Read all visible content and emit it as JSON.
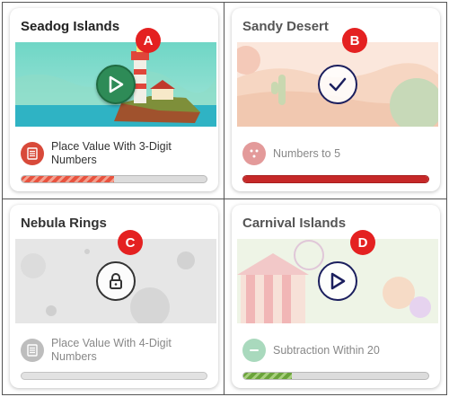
{
  "cards": [
    {
      "title": "Seadog Islands",
      "marker": "A",
      "skill": "Place Value With 3-Digit Numbers",
      "state": "play",
      "progress": 0.5,
      "icon": "play-icon",
      "skill_icon": "list-icon",
      "colors": {
        "accent": "#d84a3a",
        "button": "#2e8b57"
      }
    },
    {
      "title": "Sandy Desert",
      "marker": "B",
      "skill": "Numbers to 5",
      "state": "complete",
      "progress": 1.0,
      "icon": "checkmark-icon",
      "skill_icon": "dots-icon",
      "colors": {
        "accent": "#c62828"
      }
    },
    {
      "title": "Nebula Rings",
      "marker": "C",
      "skill": "Place Value With 4-Digit Numbers",
      "state": "locked",
      "progress": 0,
      "icon": "lock-icon",
      "skill_icon": "list-icon",
      "colors": {
        "accent": "#bdbdbd"
      }
    },
    {
      "title": "Carnival Islands",
      "marker": "D",
      "skill": "Subtraction Within 20",
      "state": "play",
      "progress": 0.26,
      "icon": "play-icon",
      "skill_icon": "minus-icon",
      "colors": {
        "accent": "#6aa33a"
      }
    }
  ]
}
